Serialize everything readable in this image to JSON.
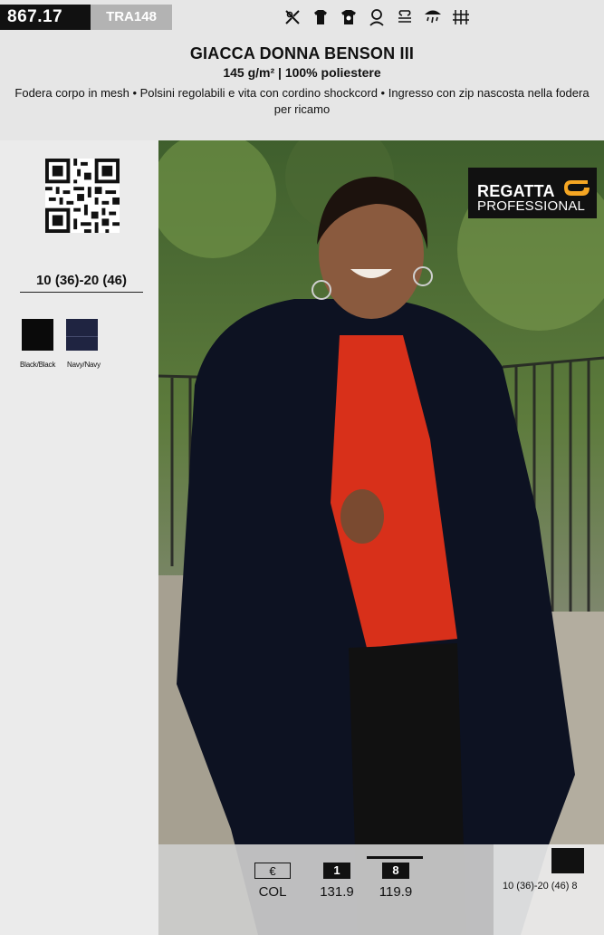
{
  "header": {
    "code_main": "867.17",
    "code_sub": "TRA148",
    "icons": [
      "no-bleach-icon",
      "wash-icon",
      "iron-icon",
      "tumble-dry-icon",
      "dry-clean-icon",
      "rain-icon",
      "wind-icon"
    ],
    "title": "GIACCA DONNA BENSON III",
    "subtitle": "145 g/m² | 100% poliestere",
    "description": "Fodera corpo in mesh • Polsini regolabili e vita con cordino shockcord • Ingresso con zip nascosta nella fodera per ricamo"
  },
  "sidebar": {
    "size_range": "10 (36)-20 (46)",
    "colors": [
      {
        "label": "Black/Black",
        "hex": "#0a0a0a"
      },
      {
        "label": "Navy/Navy",
        "hex": "#1f2441"
      }
    ]
  },
  "brand": {
    "line1": "REGATTA",
    "line2": "PROFESSIONAL",
    "accent": "#f5a623"
  },
  "pricing": {
    "currency_label": "€",
    "col_label": "COL",
    "qty_1_label": "1",
    "qty_1_price": "131.9",
    "qty_8_label": "8",
    "qty_8_price": "119.9"
  },
  "sizes_block": {
    "text": "10 (36)-20 (46) 8"
  }
}
